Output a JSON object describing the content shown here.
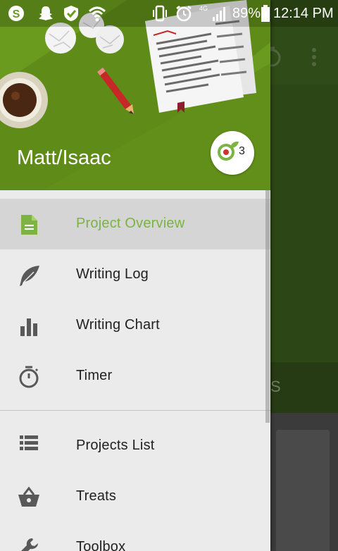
{
  "status_bar": {
    "battery_text": "89%",
    "time": "12:14 PM",
    "network_label": "4G",
    "icons": [
      "skype-icon",
      "snapchat-icon",
      "shield-check-icon",
      "wifi-icon",
      "vibrate-icon",
      "alarm-icon",
      "signal-icon",
      "battery-icon"
    ]
  },
  "drawer": {
    "user_name": "Matt/Isaac",
    "badge_count": "3",
    "menu": [
      {
        "label": "Project Overview",
        "icon": "document-icon",
        "selected": true
      },
      {
        "label": "Writing Log",
        "icon": "feather-icon",
        "selected": false
      },
      {
        "label": "Writing Chart",
        "icon": "bar-chart-icon",
        "selected": false
      },
      {
        "label": "Timer",
        "icon": "stopwatch-icon",
        "selected": false
      },
      {
        "label": "Projects List",
        "icon": "list-icon",
        "selected": false
      },
      {
        "label": "Treats",
        "icon": "basket-icon",
        "selected": false
      },
      {
        "label": "Toolbox",
        "icon": "wrench-icon",
        "selected": false
      }
    ]
  },
  "background_app": {
    "tab_label": "ICS"
  },
  "colors": {
    "header_green": "#6a9a1e",
    "accent_green": "#7cb342",
    "drawer_bg": "#ebebeb",
    "selected_bg": "#d5d5d5"
  }
}
